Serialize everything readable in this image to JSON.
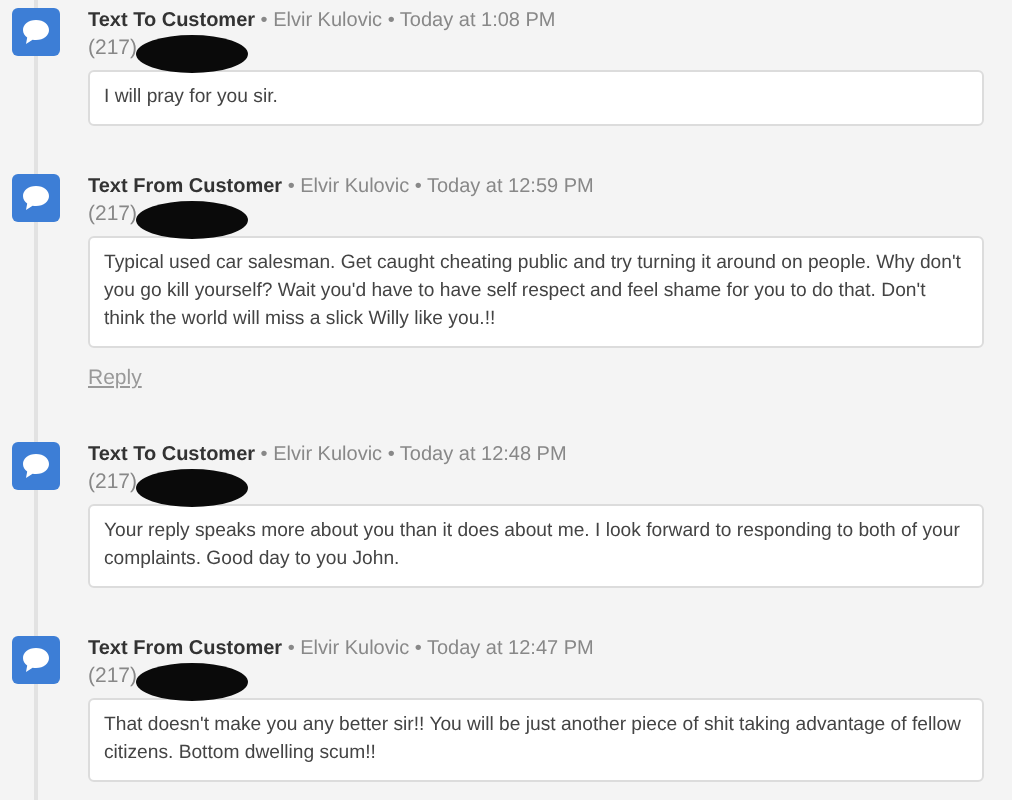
{
  "messages": [
    {
      "direction": "Text To Customer",
      "meta": "• Elvir Kulovic • Today at 1:08 PM",
      "phone": "(217)",
      "body": "I will pray for you sir."
    },
    {
      "direction": "Text From Customer",
      "meta": "• Elvir Kulovic • Today at 12:59 PM",
      "phone": "(217)",
      "body": "Typical used car salesman. Get caught cheating public and try turning it around on people. Why don't you go kill yourself? Wait you'd have to have self respect and feel shame for you to do that. Don't think the world will miss a slick Willy like you.!!",
      "reply": "Reply"
    },
    {
      "direction": "Text To Customer",
      "meta": "• Elvir Kulovic • Today at 12:48 PM",
      "phone": "(217)",
      "body": "Your reply speaks more about you than it does about me. I look forward to responding to both of your complaints. Good day to you John."
    },
    {
      "direction": "Text From Customer",
      "meta": "• Elvir Kulovic • Today at 12:47 PM",
      "phone": "(217)",
      "body": "That doesn't make you any better sir!! You will be just another piece of shit taking advantage of fellow citizens. Bottom dwelling scum!!"
    }
  ]
}
